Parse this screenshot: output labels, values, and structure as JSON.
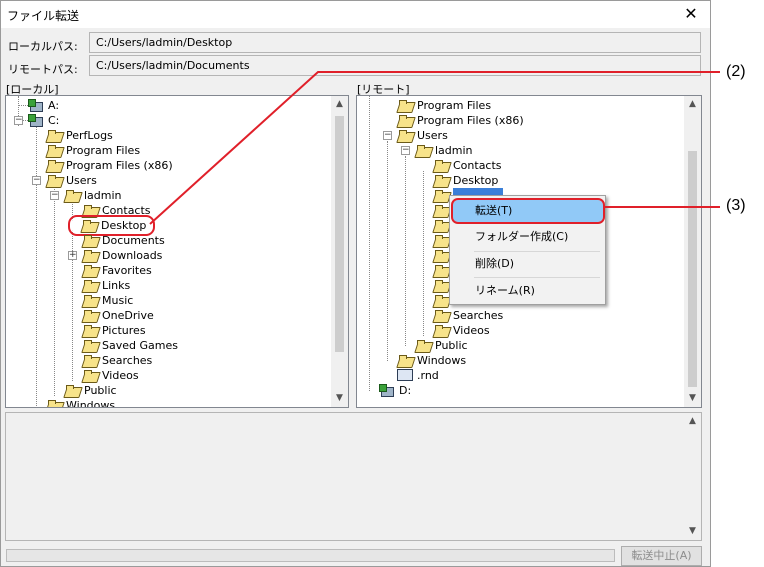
{
  "window": {
    "title": "ファイル転送",
    "close_label": "✕"
  },
  "paths": {
    "local_label": "ローカルパス:",
    "local_value": "C:/Users/ladmin/Desktop",
    "remote_label": "リモートパス:",
    "remote_value": "C:/Users/ladmin/Documents"
  },
  "local_panel": {
    "header": "[ローカル]",
    "items": [
      {
        "label": "A:",
        "icon": "drive-icon"
      },
      {
        "label": "C:",
        "icon": "drive-icon"
      },
      {
        "label": "PerfLogs",
        "icon": "folder-icon"
      },
      {
        "label": "Program Files",
        "icon": "folder-icon"
      },
      {
        "label": "Program Files (x86)",
        "icon": "folder-icon"
      },
      {
        "label": "Users",
        "icon": "folder-icon"
      },
      {
        "label": "ladmin",
        "icon": "folder-icon"
      },
      {
        "label": "Contacts",
        "icon": "folder-icon"
      },
      {
        "label": "Desktop",
        "icon": "folder-icon"
      },
      {
        "label": "Documents",
        "icon": "folder-icon"
      },
      {
        "label": "Downloads",
        "icon": "folder-icon"
      },
      {
        "label": "Favorites",
        "icon": "folder-icon"
      },
      {
        "label": "Links",
        "icon": "folder-icon"
      },
      {
        "label": "Music",
        "icon": "folder-icon"
      },
      {
        "label": "OneDrive",
        "icon": "folder-icon"
      },
      {
        "label": "Pictures",
        "icon": "folder-icon"
      },
      {
        "label": "Saved Games",
        "icon": "folder-icon"
      },
      {
        "label": "Searches",
        "icon": "folder-icon"
      },
      {
        "label": "Videos",
        "icon": "folder-icon"
      },
      {
        "label": "Public",
        "icon": "folder-icon"
      },
      {
        "label": "Windows",
        "icon": "folder-icon"
      }
    ]
  },
  "remote_panel": {
    "header": "[リモート]",
    "items": [
      {
        "label": "Program Files",
        "icon": "folder-icon"
      },
      {
        "label": "Program Files (x86)",
        "icon": "folder-icon"
      },
      {
        "label": "Users",
        "icon": "folder-icon"
      },
      {
        "label": "ladmin",
        "icon": "folder-icon"
      },
      {
        "label": "Contacts",
        "icon": "folder-icon"
      },
      {
        "label": "Desktop",
        "icon": "folder-icon"
      },
      {
        "label": "Searches",
        "icon": "folder-icon"
      },
      {
        "label": "Videos",
        "icon": "folder-icon"
      },
      {
        "label": "Public",
        "icon": "folder-icon"
      },
      {
        "label": "Windows",
        "icon": "folder-icon"
      },
      {
        "label": ".rnd",
        "icon": "file-icon"
      },
      {
        "label": "D:",
        "icon": "drive-icon"
      }
    ]
  },
  "context_menu": {
    "items": [
      {
        "label": "転送(T)",
        "selected": true
      },
      {
        "label": "フォルダー作成(C)",
        "selected": false
      },
      {
        "label": "削除(D)",
        "selected": false
      },
      {
        "label": "リネーム(R)",
        "selected": false
      }
    ]
  },
  "footer": {
    "stop_label": "転送中止(A)"
  },
  "callouts": {
    "c2": "(2)",
    "c3": "(3)"
  },
  "colors": {
    "highlight": "#e0202a",
    "menu_selected": "#91c9f7",
    "folder": "#f7e38a"
  }
}
